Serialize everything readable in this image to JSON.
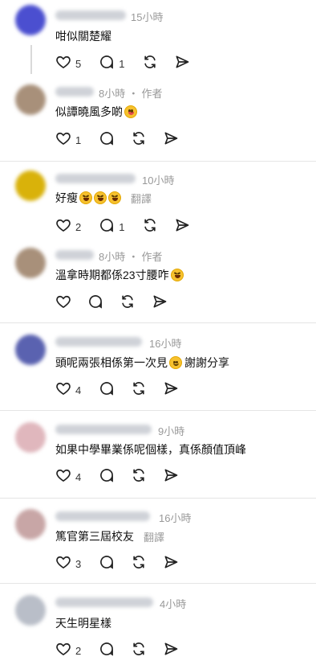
{
  "comments": [
    {
      "time": "15小時",
      "text": "咁似關楚耀",
      "likes": "5",
      "replies": "1",
      "avatar_color": "#4b4fd0",
      "emoji": "",
      "translate": ""
    },
    {
      "time": "8小時",
      "author_tag": "作者",
      "text": "似譚曉風多啲",
      "likes": "1",
      "replies": "",
      "avatar_color": "#a8907a",
      "emoji": "tongue",
      "translate": ""
    },
    {
      "time": "10小時",
      "text": "好瘦",
      "likes": "2",
      "replies": "1",
      "avatar_color": "#d9b20a",
      "emoji": "laugh3",
      "translate": "翻譯"
    },
    {
      "time": "8小時",
      "author_tag": "作者",
      "text": "溫拿時期都係23寸腰咋",
      "likes": "",
      "replies": "",
      "avatar_color": "#a8907a",
      "emoji": "laugh",
      "translate": ""
    },
    {
      "time": "16小時",
      "text": "頭呢兩張相係第一次見",
      "text2": "謝謝分享",
      "likes": "4",
      "replies": "",
      "avatar_color": "#5a62b0",
      "emoji": "smile",
      "translate": ""
    },
    {
      "time": "9小時",
      "text": "如果中學畢業係呢個樣，真係顏值頂峰",
      "likes": "4",
      "replies": "",
      "avatar_color": "#e0b7bd",
      "emoji": "",
      "translate": ""
    },
    {
      "time": "16小時",
      "text": "篤官第三屆校友",
      "likes": "3",
      "replies": "",
      "avatar_color": "#c8a6a6",
      "emoji": "",
      "translate": "翻譯"
    },
    {
      "time": "4小時",
      "text": "天生明星樣",
      "likes": "2",
      "replies": "",
      "avatar_color": "#b9bec8",
      "emoji": "",
      "translate": ""
    }
  ],
  "icons": {
    "like": "heart-icon",
    "reply": "comment-icon",
    "repost": "repost-icon",
    "share": "send-icon"
  },
  "separator": "・"
}
